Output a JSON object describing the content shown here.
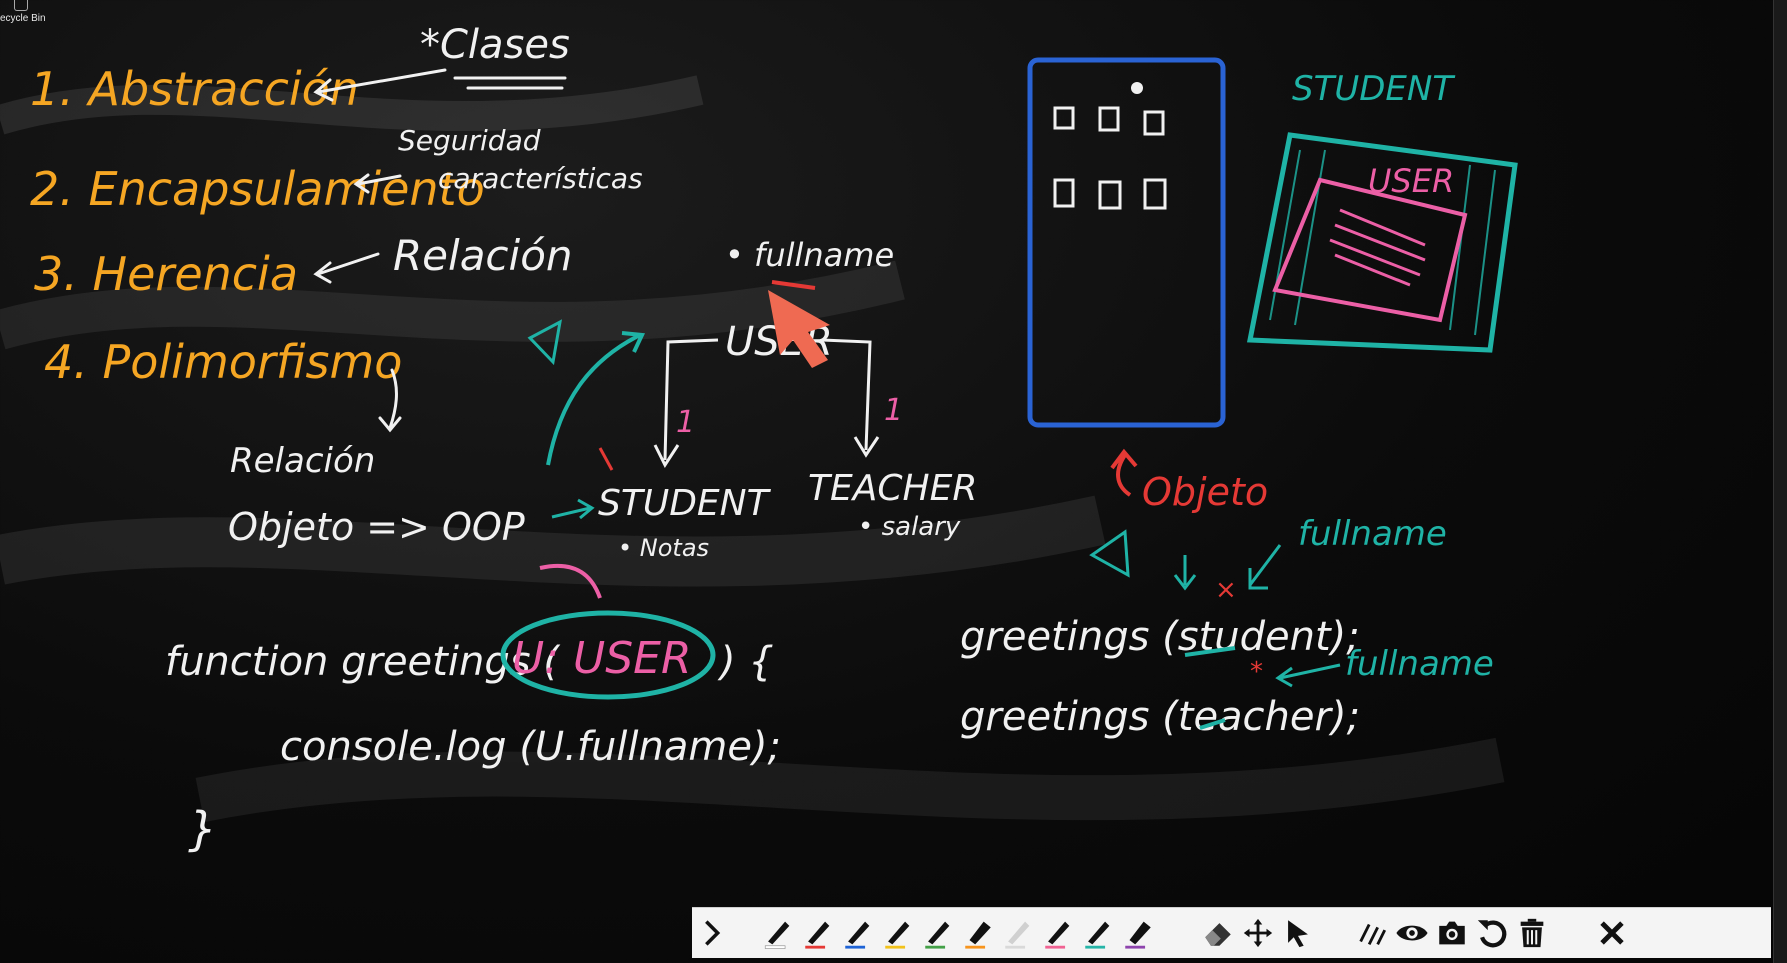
{
  "desktop": {
    "recycle_bin_label": "ecycle Bin"
  },
  "board": {
    "list": {
      "item1": "1. Abstracción",
      "item2": "2. Encapsulamiento",
      "item3": "3. Herencia",
      "item4": "4. Polimorfismo"
    },
    "notes": {
      "clases": "*Clases",
      "seguridad": "Seguridad",
      "caracteristicas": "características",
      "relacion": "Relación",
      "relacion_small": "Relación",
      "objeto_oop": "Objeto => OOP"
    },
    "diagram": {
      "fullname_top": "• fullname",
      "user": "USER",
      "one_left": "1",
      "one_right": "1",
      "student": "STUDENT",
      "notas": "• Notas",
      "teacher": "TEACHER",
      "salary": "• salary"
    },
    "code": {
      "function_line_a": "function greetings (",
      "param": "U: USER",
      "function_line_b": ") {",
      "console_line": "console.log (U.fullname);",
      "closing": "}"
    },
    "right": {
      "student_label": "STUDENT",
      "user_label": "USER",
      "objeto": "Objeto",
      "fullname_1": "fullname",
      "fullname_2": "fullname",
      "call_student": "greetings (student);",
      "call_teacher": "greetings (teacher);"
    }
  },
  "toolbar": {
    "tools": [
      {
        "name": "collapse-chevron-icon"
      },
      {
        "name": "pen-white-icon",
        "color": "#ffffff"
      },
      {
        "name": "pen-red-icon",
        "color": "#e53935"
      },
      {
        "name": "pen-blue-icon",
        "color": "#1e63d6"
      },
      {
        "name": "pen-yellow-icon",
        "color": "#f2c21b"
      },
      {
        "name": "pen-green-icon",
        "color": "#43a047"
      },
      {
        "name": "highlighter-orange-icon",
        "color": "#f7941d"
      },
      {
        "name": "pen-lightgray-icon",
        "color": "#d9d9d9"
      },
      {
        "name": "pen-pink-icon",
        "color": "#f06292"
      },
      {
        "name": "pen-teal-icon",
        "color": "#26b5a8"
      },
      {
        "name": "highlighter-purple-icon",
        "color": "#8e44ad"
      },
      {
        "name": "eraser-icon"
      },
      {
        "name": "move-icon"
      },
      {
        "name": "pointer-icon"
      },
      {
        "name": "line-style-icon"
      },
      {
        "name": "visibility-icon"
      },
      {
        "name": "camera-icon"
      },
      {
        "name": "undo-icon"
      },
      {
        "name": "trash-icon"
      },
      {
        "name": "close-icon"
      }
    ]
  },
  "colors": {
    "orange": "#f5a623",
    "white": "#f1f1f1",
    "teal": "#1fb3a6",
    "pink": "#ec5fa6",
    "blue": "#2a63d4",
    "red": "#e53935",
    "salmon": "#ef6a52"
  }
}
